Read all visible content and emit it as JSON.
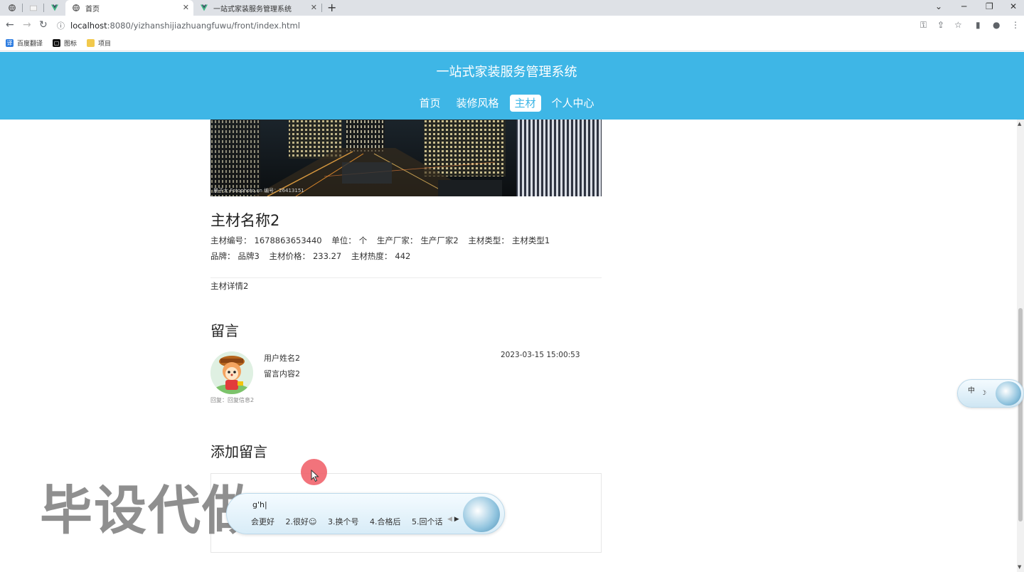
{
  "browser": {
    "tabs": [
      {
        "label": ""
      },
      {
        "label": ""
      },
      {
        "label": ""
      },
      {
        "label": "首页"
      },
      {
        "label": "一站式家装服务管理系统"
      }
    ],
    "url_host": "localhost",
    "url_path": ":8080/yizhanshijiazhuangfuwu/front/index.html",
    "bookmarks": [
      {
        "label": "百度翻译"
      },
      {
        "label": "图标"
      },
      {
        "label": "项目"
      }
    ]
  },
  "site": {
    "title": "一站式家装服务管理系统",
    "nav": [
      {
        "label": "首页",
        "active": false
      },
      {
        "label": "装修风格",
        "active": false
      },
      {
        "label": "主材",
        "active": true
      },
      {
        "label": "个人中心",
        "active": false
      }
    ]
  },
  "banner": {
    "credit": "晨子大 Fotophoto.cn 编号：26413151"
  },
  "product": {
    "name": "主材名称2",
    "code_label": "主材编号：",
    "code": "1678863653440",
    "unit_label": "单位：",
    "unit": "个",
    "maker_label": "生产厂家：",
    "maker": "生产厂家2",
    "type_label": "主材类型：",
    "type": "主材类型1",
    "brand_label": "品牌：",
    "brand": "品牌3",
    "price_label": "主材价格：",
    "price": "233.27",
    "heat_label": "主材热度：",
    "heat": "442",
    "detail": "主材详情2"
  },
  "comments": {
    "title": "留言",
    "items": [
      {
        "user": "用户姓名2",
        "content": "留言内容2",
        "time": "2023-03-15 15:00:53",
        "reply": "回复：回复信息2"
      }
    ]
  },
  "add_comment": {
    "title": "添加留言"
  },
  "ime": {
    "typed": "g'h|",
    "candidates": [
      "会更好",
      "2.很好☺",
      "3.换个号",
      "4.合格后",
      "5.回个话"
    ],
    "status_text": "中"
  },
  "watermark": "毕设代做",
  "colors": {
    "header_bg": "#3eb6e6",
    "nav_active_text": "#3eb6e6"
  }
}
